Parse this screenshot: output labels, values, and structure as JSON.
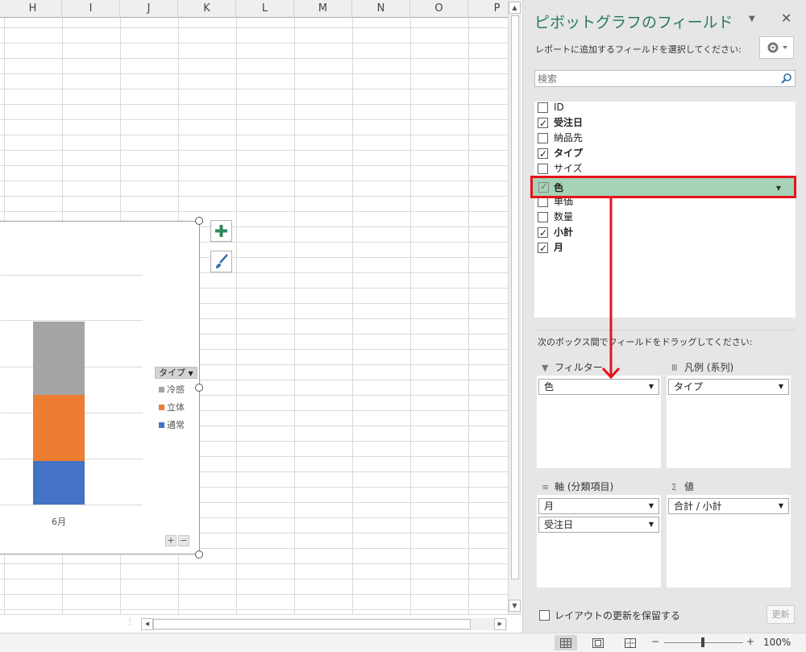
{
  "sheet": {
    "columns": [
      "H",
      "I",
      "J",
      "K",
      "L",
      "M",
      "N",
      "O",
      "P"
    ]
  },
  "chart_data": {
    "type": "bar",
    "stacked": true,
    "categories": [
      "6月"
    ],
    "series": [
      {
        "name": "通常",
        "color": "#4472C4",
        "values": [
          24
        ]
      },
      {
        "name": "立体",
        "color": "#ED7D31",
        "values": [
          36
        ]
      },
      {
        "name": "冷感",
        "color": "#A5A5A5",
        "values": [
          40
        ]
      }
    ],
    "legend_title": "タイプ",
    "legend_placement": "right",
    "grid": true
  },
  "chart_ui": {
    "legend_filter_label": "タイプ",
    "expand_label": "+",
    "collapse_label": "−",
    "add_element_icon": "plus-icon",
    "style_icon": "brush-icon"
  },
  "pane": {
    "title": "ピボットグラフのフィールド",
    "subtitle": "レポートに追加するフィールドを選択してください:",
    "search_placeholder": "検索",
    "fields": [
      {
        "label": "ID",
        "checked": false,
        "bold": false
      },
      {
        "label": "受注日",
        "checked": true,
        "bold": true
      },
      {
        "label": "納品先",
        "checked": false,
        "bold": false
      },
      {
        "label": "タイプ",
        "checked": true,
        "bold": true
      },
      {
        "label": "サイズ",
        "checked": false,
        "bold": false
      },
      {
        "label": "色",
        "checked": true,
        "bold": true,
        "dragging": true
      },
      {
        "label": "単価",
        "checked": false,
        "bold": false
      },
      {
        "label": "数量",
        "checked": false,
        "bold": false
      },
      {
        "label": "小計",
        "checked": true,
        "bold": true
      },
      {
        "label": "月",
        "checked": true,
        "bold": true
      }
    ],
    "drag_hint": "次のボックス間でフィールドをドラッグしてください:",
    "areas": {
      "filter": {
        "title": "フィルター",
        "items": [
          "色"
        ]
      },
      "legend": {
        "title": "凡例 (系列)",
        "items": [
          "タイプ"
        ]
      },
      "axis": {
        "title": "軸 (分類項目)",
        "items": [
          "月",
          "受注日"
        ]
      },
      "values": {
        "title": "値",
        "items": [
          "合計 / 小計"
        ]
      }
    },
    "defer_label": "レイアウトの更新を保留する",
    "update_label": "更新",
    "highlight_color": "#e8121b"
  },
  "status": {
    "zoom_minus": "−",
    "zoom_plus": "+",
    "zoom": "100%"
  }
}
